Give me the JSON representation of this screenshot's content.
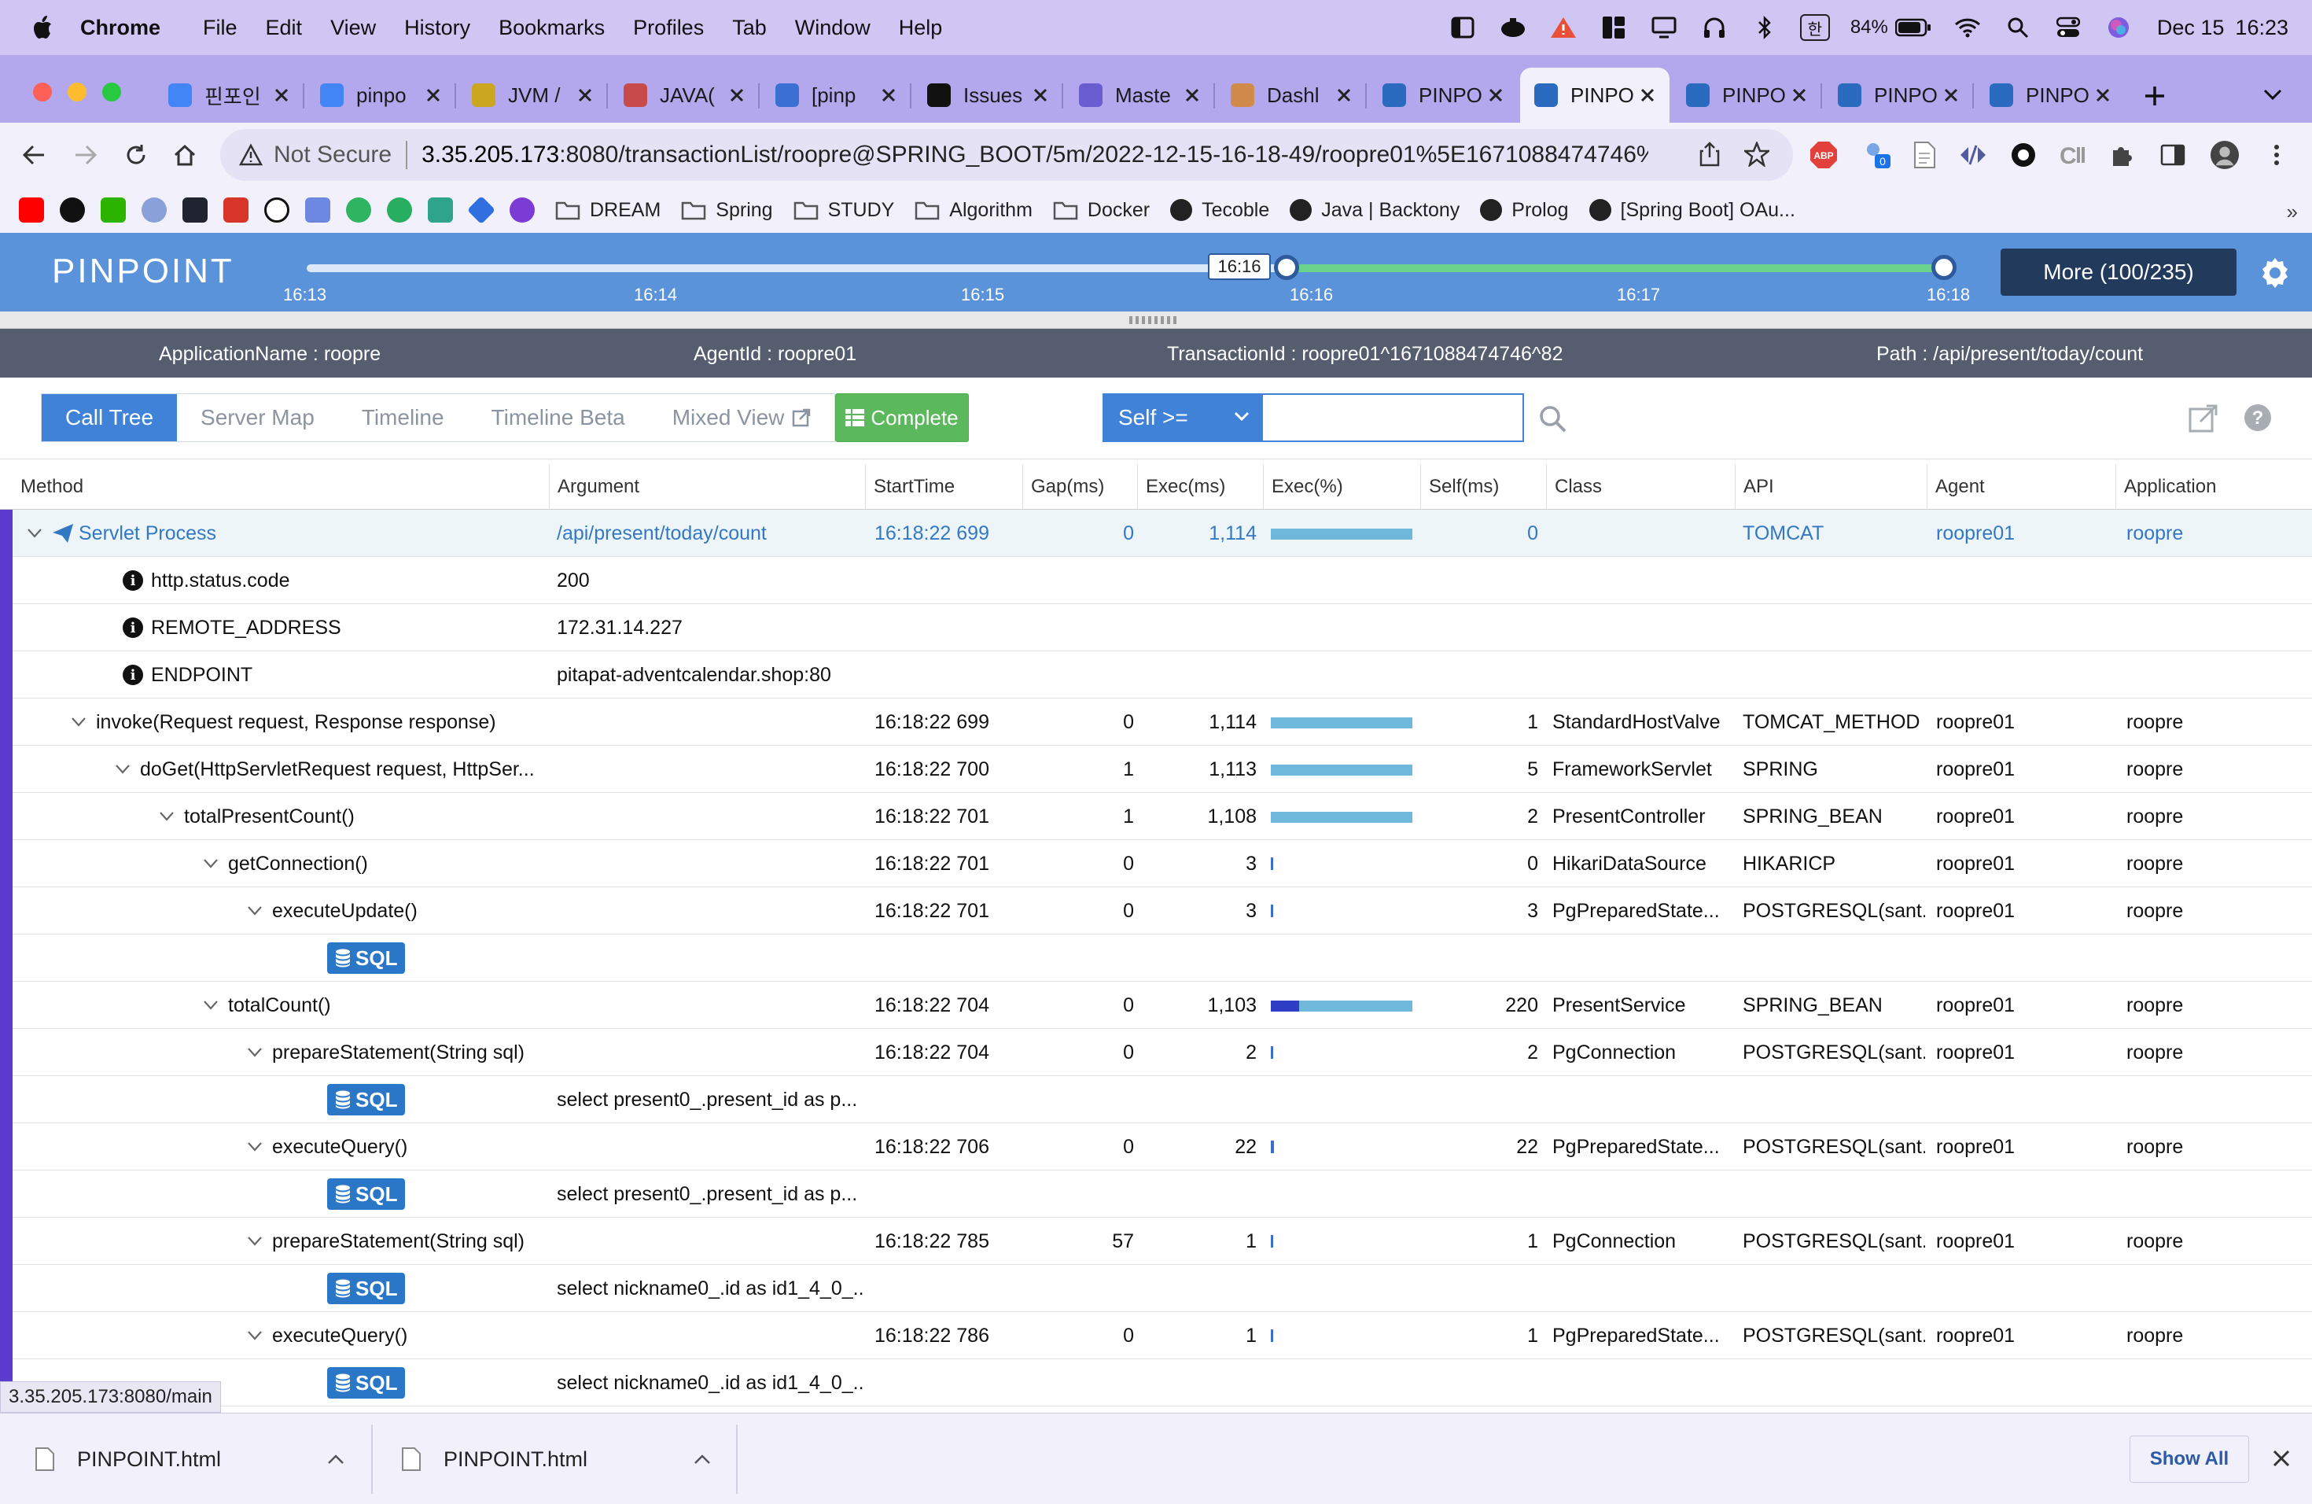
{
  "menubar": {
    "app": "Chrome",
    "items": [
      "File",
      "Edit",
      "View",
      "History",
      "Bookmarks",
      "Profiles",
      "Tab",
      "Window",
      "Help"
    ],
    "ime": "한",
    "battery": "84%",
    "date": "Dec 15",
    "time": "16:23"
  },
  "tabs": [
    {
      "label": "핀포인",
      "color": "#4285f4"
    },
    {
      "label": "pinpo",
      "color": "#4285f4"
    },
    {
      "label": "JVM /",
      "color": "#caa71f"
    },
    {
      "label": "JAVA(",
      "color": "#c94a4a"
    },
    {
      "label": "[pinp",
      "color": "#3b6fd1"
    },
    {
      "label": "Issues",
      "color": "#111111"
    },
    {
      "label": "Maste",
      "color": "#6a5cd1"
    },
    {
      "label": "Dashl",
      "color": "#d08a4a"
    },
    {
      "label": "PINPO",
      "color": "#2a6bbf"
    },
    {
      "label": "PINPO",
      "color": "#2a6bbf"
    },
    {
      "label": "PINPO",
      "color": "#2a6bbf"
    },
    {
      "label": "PINPO",
      "color": "#2a6bbf"
    },
    {
      "label": "PINPO",
      "color": "#2a6bbf"
    }
  ],
  "active_tab_index": 9,
  "omnibox": {
    "security": "Not Secure",
    "host": "3.35.205.173",
    "rest": ":8080/transactionList/roopre@SPRING_BOOT/5m/2022-12-15-16-18-49/roopre01%5E1671088474746%5E..."
  },
  "bookmarks": [
    {
      "label": "DREAM",
      "type": "folder"
    },
    {
      "label": "Spring",
      "type": "folder"
    },
    {
      "label": "STUDY",
      "type": "folder"
    },
    {
      "label": "Algorithm",
      "type": "folder"
    },
    {
      "label": "Docker",
      "type": "folder"
    },
    {
      "label": "Tecoble",
      "type": "site"
    },
    {
      "label": "Java | Backtony",
      "type": "site"
    },
    {
      "label": "Prolog",
      "type": "site"
    },
    {
      "label": "[Spring Boot] OAu...",
      "type": "site"
    }
  ],
  "pinpoint": {
    "logo": "PINPOINT",
    "timeline_ticks": [
      "16:13",
      "16:14",
      "16:15",
      "16:16",
      "16:17",
      "16:18"
    ],
    "handle_label": "16:16",
    "more_button": "More (100/235)"
  },
  "info": {
    "application_name": "ApplicationName : roopre",
    "agent_id": "AgentId : roopre01",
    "transaction_id": "TransactionId : roopre01^1671088474746^82",
    "path": "Path : /api/present/today/count"
  },
  "view_tabs": [
    "Call Tree",
    "Server Map",
    "Timeline",
    "Timeline Beta",
    "Mixed View"
  ],
  "complete_button": "Complete",
  "self_select": "Self >=",
  "self_input": "",
  "columns": [
    "Method",
    "Argument",
    "StartTime",
    "Gap(ms)",
    "Exec(ms)",
    "Exec(%)",
    "Self(ms)",
    "Class",
    "API",
    "Agent",
    "Application"
  ],
  "rows": [
    {
      "method": "Servlet Process",
      "arg": "/api/present/today/count",
      "start": "16:18:22 699",
      "gap": "0",
      "exec": "1,114",
      "pct": 100,
      "selfpct": 0,
      "self": "0",
      "class": "",
      "api": "TOMCAT",
      "agent": "roopre01",
      "app": "roopre",
      "indent": 0,
      "kind": "root"
    },
    {
      "method": "http.status.code",
      "arg": "200",
      "start": "",
      "gap": "",
      "exec": "",
      "pct": null,
      "selfpct": 0,
      "self": "",
      "class": "",
      "api": "",
      "agent": "",
      "app": "",
      "indent": 1,
      "kind": "info"
    },
    {
      "method": "REMOTE_ADDRESS",
      "arg": "172.31.14.227",
      "start": "",
      "gap": "",
      "exec": "",
      "pct": null,
      "selfpct": 0,
      "self": "",
      "class": "",
      "api": "",
      "agent": "",
      "app": "",
      "indent": 1,
      "kind": "info"
    },
    {
      "method": "ENDPOINT",
      "arg": "pitapat-adventcalendar.shop:80",
      "start": "",
      "gap": "",
      "exec": "",
      "pct": null,
      "selfpct": 0,
      "self": "",
      "class": "",
      "api": "",
      "agent": "",
      "app": "",
      "indent": 1,
      "kind": "info"
    },
    {
      "method": "invoke(Request request, Response response)",
      "arg": "",
      "start": "16:18:22 699",
      "gap": "0",
      "exec": "1,114",
      "pct": 100,
      "selfpct": 0,
      "self": "1",
      "class": "StandardHostValve",
      "api": "TOMCAT_METHOD",
      "agent": "roopre01",
      "app": "roopre",
      "indent": 1,
      "kind": "method"
    },
    {
      "method": "doGet(HttpServletRequest request, HttpSer...",
      "arg": "",
      "start": "16:18:22 700",
      "gap": "1",
      "exec": "1,113",
      "pct": 100,
      "selfpct": 0,
      "self": "5",
      "class": "FrameworkServlet",
      "api": "SPRING",
      "agent": "roopre01",
      "app": "roopre",
      "indent": 2,
      "kind": "method"
    },
    {
      "method": "totalPresentCount()",
      "arg": "",
      "start": "16:18:22 701",
      "gap": "1",
      "exec": "1,108",
      "pct": 100,
      "selfpct": 0,
      "self": "2",
      "class": "PresentController",
      "api": "SPRING_BEAN",
      "agent": "roopre01",
      "app": "roopre",
      "indent": 3,
      "kind": "method"
    },
    {
      "method": "getConnection()",
      "arg": "",
      "start": "16:18:22 701",
      "gap": "0",
      "exec": "3",
      "pct": 0,
      "selfpct": 0,
      "self": "0",
      "class": "HikariDataSource",
      "api": "HIKARICP",
      "agent": "roopre01",
      "app": "roopre",
      "indent": 4,
      "kind": "method"
    },
    {
      "method": "executeUpdate()",
      "arg": "",
      "start": "16:18:22 701",
      "gap": "0",
      "exec": "3",
      "pct": 0,
      "selfpct": 0,
      "self": "3",
      "class": "PgPreparedState...",
      "api": "POSTGRESQL(sant...",
      "agent": "roopre01",
      "app": "roopre",
      "indent": 5,
      "kind": "method"
    },
    {
      "method": "SQL",
      "arg": "",
      "start": "",
      "gap": "",
      "exec": "",
      "pct": null,
      "selfpct": 0,
      "self": "",
      "class": "",
      "api": "",
      "agent": "",
      "app": "",
      "indent": 6,
      "kind": "sql"
    },
    {
      "method": "totalCount()",
      "arg": "",
      "start": "16:18:22 704",
      "gap": "0",
      "exec": "1,103",
      "pct": 100,
      "selfpct": 20,
      "self": "220",
      "class": "PresentService",
      "api": "SPRING_BEAN",
      "agent": "roopre01",
      "app": "roopre",
      "indent": 4,
      "kind": "method"
    },
    {
      "method": "prepareStatement(String sql)",
      "arg": "",
      "start": "16:18:22 704",
      "gap": "0",
      "exec": "2",
      "pct": 0,
      "selfpct": 0,
      "self": "2",
      "class": "PgConnection",
      "api": "POSTGRESQL(sant...",
      "agent": "roopre01",
      "app": "roopre",
      "indent": 5,
      "kind": "method"
    },
    {
      "method": "SQL",
      "arg": "select present0_.present_id as p...",
      "start": "",
      "gap": "",
      "exec": "",
      "pct": null,
      "selfpct": 0,
      "self": "",
      "class": "",
      "api": "",
      "agent": "",
      "app": "",
      "indent": 6,
      "kind": "sql"
    },
    {
      "method": "executeQuery()",
      "arg": "",
      "start": "16:18:22 706",
      "gap": "0",
      "exec": "22",
      "pct": 2,
      "selfpct": 0,
      "self": "22",
      "class": "PgPreparedState...",
      "api": "POSTGRESQL(sant...",
      "agent": "roopre01",
      "app": "roopre",
      "indent": 5,
      "kind": "method"
    },
    {
      "method": "SQL",
      "arg": "select present0_.present_id as p...",
      "start": "",
      "gap": "",
      "exec": "",
      "pct": null,
      "selfpct": 0,
      "self": "",
      "class": "",
      "api": "",
      "agent": "",
      "app": "",
      "indent": 6,
      "kind": "sql"
    },
    {
      "method": "prepareStatement(String sql)",
      "arg": "",
      "start": "16:18:22 785",
      "gap": "57",
      "exec": "1",
      "pct": 0,
      "selfpct": 0,
      "self": "1",
      "class": "PgConnection",
      "api": "POSTGRESQL(sant...",
      "agent": "roopre01",
      "app": "roopre",
      "indent": 5,
      "kind": "method"
    },
    {
      "method": "SQL",
      "arg": "select nickname0_.id as id1_4_0_...",
      "start": "",
      "gap": "",
      "exec": "",
      "pct": null,
      "selfpct": 0,
      "self": "",
      "class": "",
      "api": "",
      "agent": "",
      "app": "",
      "indent": 6,
      "kind": "sql"
    },
    {
      "method": "executeQuery()",
      "arg": "",
      "start": "16:18:22 786",
      "gap": "0",
      "exec": "1",
      "pct": 0,
      "selfpct": 0,
      "self": "1",
      "class": "PgPreparedState...",
      "api": "POSTGRESQL(sant...",
      "agent": "roopre01",
      "app": "roopre",
      "indent": 5,
      "kind": "method"
    },
    {
      "method": "SQL",
      "arg": "select nickname0_.id as id1_4_0_...",
      "start": "",
      "gap": "",
      "exec": "",
      "pct": null,
      "selfpct": 0,
      "self": "",
      "class": "",
      "api": "",
      "agent": "",
      "app": "",
      "indent": 6,
      "kind": "sql"
    }
  ],
  "status_url": "3.35.205.173:8080/main",
  "downloads": [
    "PINPOINT.html",
    "PINPOINT.html"
  ],
  "show_all": "Show All"
}
